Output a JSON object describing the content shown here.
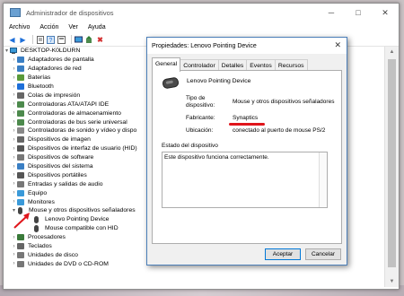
{
  "window": {
    "title": "Administrador de dispositivos",
    "controls": {
      "minimize": "─",
      "maximize": "□",
      "close": "✕"
    }
  },
  "menu": [
    "Archivo",
    "Acción",
    "Ver",
    "Ayuda"
  ],
  "toolbar": [
    "back-icon",
    "forward-icon",
    "properties-icon",
    "help-icon",
    "view-icon",
    "monitor-icon",
    "update-driver-icon",
    "uninstall-icon"
  ],
  "tree": {
    "root": "DESKTOP-K0LDURN",
    "items": [
      {
        "label": "Adaptadores de pantalla",
        "icon": "display-adapter-icon",
        "color": "#3a7fc4"
      },
      {
        "label": "Adaptadores de red",
        "icon": "network-adapter-icon",
        "color": "#3a7fc4"
      },
      {
        "label": "Baterías",
        "icon": "battery-icon",
        "color": "#5a9a3a"
      },
      {
        "label": "Bluetooth",
        "icon": "bluetooth-icon",
        "color": "#1e6fd9"
      },
      {
        "label": "Colas de impresión",
        "icon": "printer-icon",
        "color": "#666666"
      },
      {
        "label": "Controladoras ATA/ATAPI IDE",
        "icon": "ide-controller-icon",
        "color": "#4d8a4d"
      },
      {
        "label": "Controladoras de almacenamiento",
        "icon": "storage-controller-icon",
        "color": "#4d8a4d"
      },
      {
        "label": "Controladoras de bus serie universal",
        "icon": "usb-controller-icon",
        "color": "#4d8a4d"
      },
      {
        "label": "Controladoras de sonido y vídeo y dispo",
        "icon": "sound-icon",
        "color": "#888888"
      },
      {
        "label": "Dispositivos de imagen",
        "icon": "camera-icon",
        "color": "#666666"
      },
      {
        "label": "Dispositivos de interfaz de usuario (HID)",
        "icon": "hid-icon",
        "color": "#555555"
      },
      {
        "label": "Dispositivos de software",
        "icon": "software-device-icon",
        "color": "#777777"
      },
      {
        "label": "Dispositivos del sistema",
        "icon": "system-device-icon",
        "color": "#3a7fc4"
      },
      {
        "label": "Dispositivos portátiles",
        "icon": "portable-device-icon",
        "color": "#555555"
      },
      {
        "label": "Entradas y salidas de audio",
        "icon": "audio-io-icon",
        "color": "#777777"
      },
      {
        "label": "Equipo",
        "icon": "computer-icon",
        "color": "#3a9ad9"
      },
      {
        "label": "Monitores",
        "icon": "monitor-icon",
        "color": "#3a9ad9"
      },
      {
        "label": "Mouse y otros dispositivos señaladores",
        "icon": "mouse-icon",
        "color": "#444444",
        "expanded": true
      },
      {
        "label": "Lenovo Pointing Device",
        "icon": "mouse-icon",
        "color": "#444444",
        "child": true
      },
      {
        "label": "Mouse compatible con HID",
        "icon": "mouse-icon",
        "color": "#444444",
        "child": true
      },
      {
        "label": "Procesadores",
        "icon": "processor-icon",
        "color": "#3a7a3a"
      },
      {
        "label": "Teclados",
        "icon": "keyboard-icon",
        "color": "#666666"
      },
      {
        "label": "Unidades de disco",
        "icon": "disk-drive-icon",
        "color": "#777777"
      },
      {
        "label": "Unidades de DVD o CD-ROM",
        "icon": "dvd-drive-icon",
        "color": "#777777"
      }
    ]
  },
  "dialog": {
    "title": "Propiedades: Lenovo Pointing Device",
    "close": "✕",
    "tabs": [
      "General",
      "Controlador",
      "Detalles",
      "Eventos",
      "Recursos"
    ],
    "active_tab": "General",
    "device_name": "Lenovo Pointing Device",
    "props": [
      {
        "label": "Tipo de\ndispositivo:",
        "value": "Mouse y otros dispositivos señaladores"
      },
      {
        "label": "Fabricante:",
        "value": "Synaptics"
      },
      {
        "label": "Ubicación:",
        "value": "conectado al puerto de mouse PS/2"
      }
    ],
    "status_title": "Estado del dispositivo",
    "status_text": "Este dispositivo funciona correctamente.",
    "ok": "Aceptar",
    "cancel": "Cancelar"
  },
  "accent": {
    "highlight": "#e0151b",
    "dialog_border": "#4a7eb8"
  }
}
